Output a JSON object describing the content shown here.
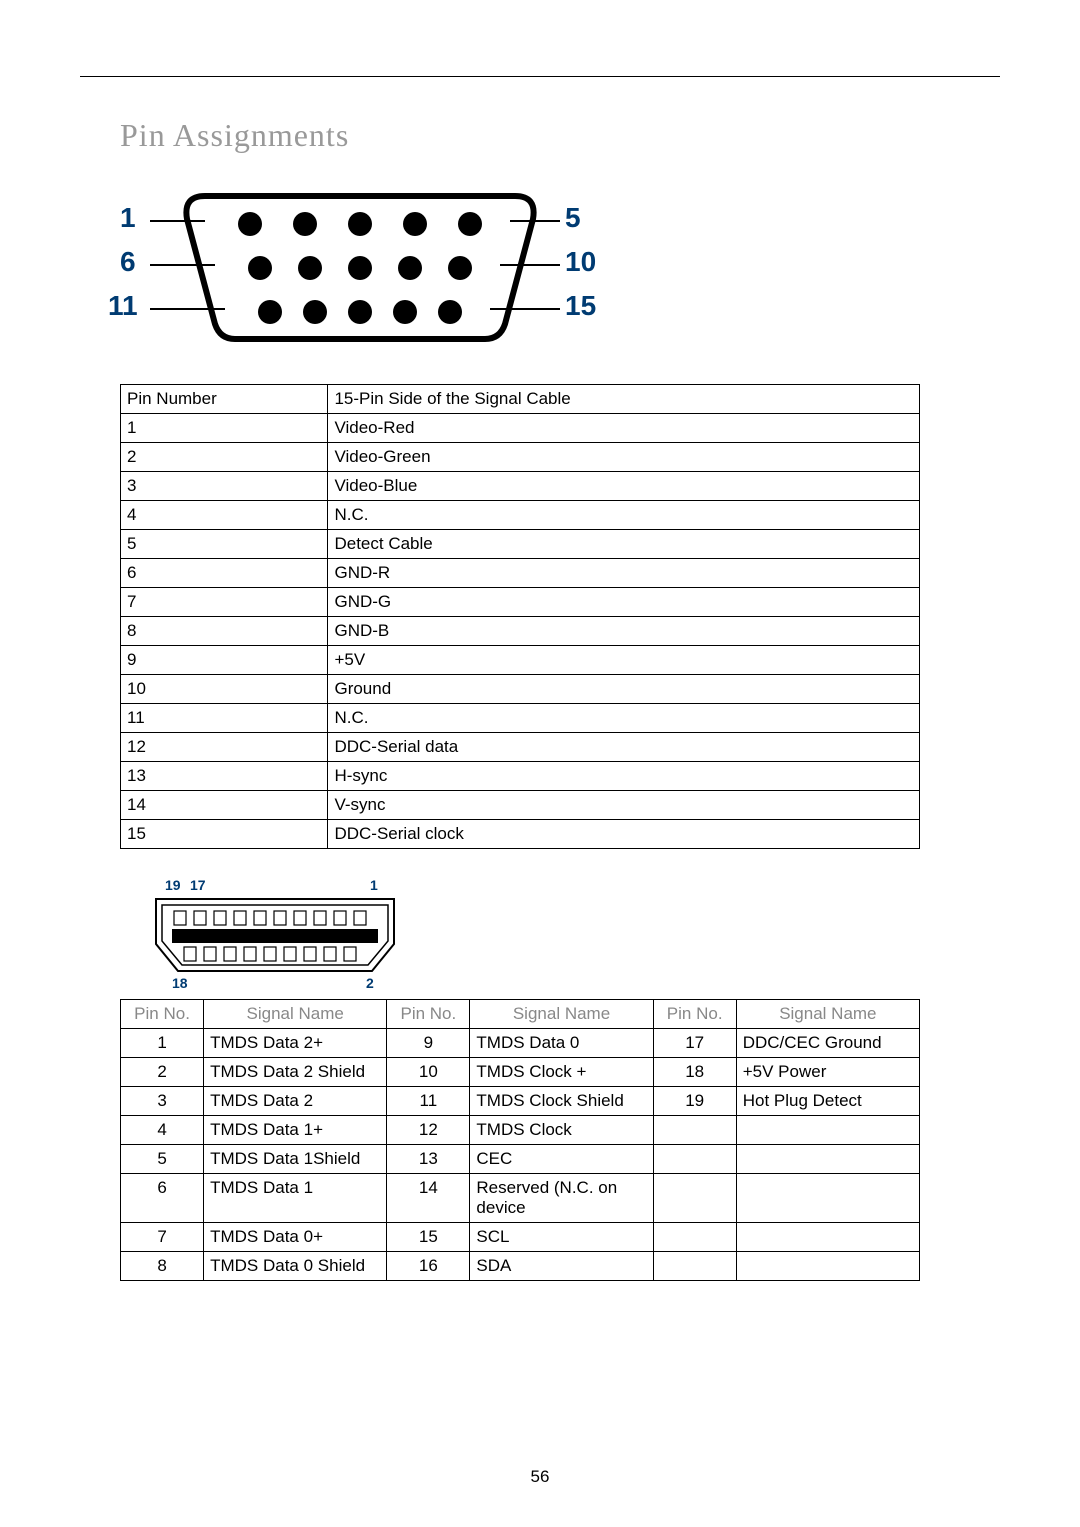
{
  "title": "Pin Assignments",
  "page_number": "56",
  "vga_diagram": {
    "labels": {
      "l1": "1",
      "l6": "6",
      "l11": "11",
      "l5": "5",
      "l10": "10",
      "l15": "15"
    }
  },
  "vga_table": {
    "header": {
      "pin": "Pin Number",
      "sig": "15-Pin Side of the Signal Cable"
    },
    "rows": [
      {
        "pin": "1",
        "sig": "Video-Red"
      },
      {
        "pin": "2",
        "sig": "Video-Green"
      },
      {
        "pin": "3",
        "sig": "Video-Blue"
      },
      {
        "pin": "4",
        "sig": "N.C."
      },
      {
        "pin": "5",
        "sig": "Detect Cable"
      },
      {
        "pin": "6",
        "sig": "GND-R"
      },
      {
        "pin": "7",
        "sig": "GND-G"
      },
      {
        "pin": "8",
        "sig": "GND-B"
      },
      {
        "pin": "9",
        "sig": "+5V"
      },
      {
        "pin": "10",
        "sig": "Ground"
      },
      {
        "pin": "11",
        "sig": "N.C."
      },
      {
        "pin": "12",
        "sig": "DDC-Serial data"
      },
      {
        "pin": "13",
        "sig": "H-sync"
      },
      {
        "pin": "14",
        "sig": "V-sync"
      },
      {
        "pin": "15",
        "sig": "DDC-Serial clock"
      }
    ]
  },
  "hdmi_diagram": {
    "labels": {
      "tl": "19",
      "tl2": "17",
      "tr": "1",
      "bl": "18",
      "br": "2"
    }
  },
  "hdmi_table": {
    "headers": {
      "pin": "Pin No.",
      "name": "Signal Name"
    },
    "rows": [
      {
        "p1": "1",
        "n1": "TMDS Data 2+",
        "p2": "9",
        "n2": "TMDS Data 0",
        "p3": "17",
        "n3": "DDC/CEC Ground"
      },
      {
        "p1": "2",
        "n1": "TMDS Data 2 Shield",
        "p2": "10",
        "n2": "TMDS Clock +",
        "p3": "18",
        "n3": "+5V Power"
      },
      {
        "p1": "3",
        "n1": "TMDS Data 2",
        "p2": "11",
        "n2": "TMDS Clock Shield",
        "p3": "19",
        "n3": "Hot Plug Detect"
      },
      {
        "p1": "4",
        "n1": "TMDS Data 1+",
        "p2": "12",
        "n2": "TMDS Clock",
        "p3": "",
        "n3": ""
      },
      {
        "p1": "5",
        "n1": "TMDS Data 1Shield",
        "p2": "13",
        "n2": "CEC",
        "p3": "",
        "n3": ""
      },
      {
        "p1": "6",
        "n1": "TMDS Data 1",
        "p2": "14",
        "n2": "Reserved (N.C. on device",
        "p3": "",
        "n3": ""
      },
      {
        "p1": "7",
        "n1": "TMDS Data 0+",
        "p2": "15",
        "n2": "SCL",
        "p3": "",
        "n3": ""
      },
      {
        "p1": "8",
        "n1": "TMDS Data 0 Shield",
        "p2": "16",
        "n2": "SDA",
        "p3": "",
        "n3": ""
      }
    ]
  }
}
